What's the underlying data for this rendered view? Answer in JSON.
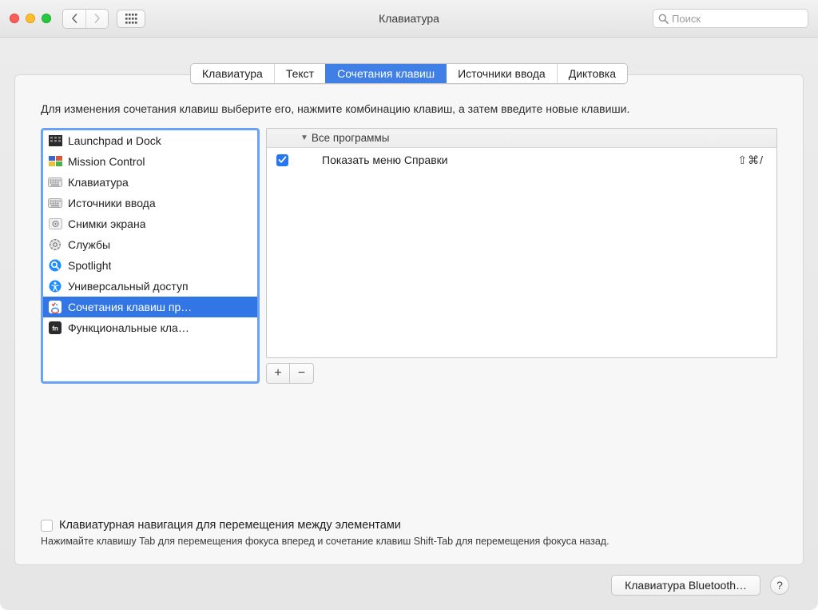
{
  "window": {
    "title": "Клавиатура"
  },
  "search": {
    "placeholder": "Поиск"
  },
  "tabs": [
    "Клавиатура",
    "Текст",
    "Сочетания клавиш",
    "Источники ввода",
    "Диктовка"
  ],
  "activeTab": 2,
  "instruction": "Для изменения сочетания клавиш выберите его, нажмите комбинацию клавиш, а затем введите новые клавиши.",
  "categories": [
    {
      "label": "Launchpad и Dock",
      "icon": "launchpad"
    },
    {
      "label": "Mission Control",
      "icon": "mission"
    },
    {
      "label": "Клавиатура",
      "icon": "keyboard"
    },
    {
      "label": "Источники ввода",
      "icon": "keyboard"
    },
    {
      "label": "Снимки экрана",
      "icon": "screenshot"
    },
    {
      "label": "Службы",
      "icon": "gear"
    },
    {
      "label": "Spotlight",
      "icon": "spotlight"
    },
    {
      "label": "Универсальный доступ",
      "icon": "accessibility"
    },
    {
      "label": "Сочетания клавиш пр…",
      "icon": "apps",
      "selected": true
    },
    {
      "label": "Функциональные кла…",
      "icon": "fn"
    }
  ],
  "detail": {
    "header": "Все программы",
    "items": [
      {
        "checked": true,
        "label": "Показать меню Справки",
        "shortcut": "⇧⌘/"
      }
    ]
  },
  "buttons": {
    "add": "+",
    "remove": "−"
  },
  "kbnav": {
    "label": "Клавиатурная навигация для перемещения между элементами",
    "hint": "Нажимайте клавишу Tab для перемещения фокуса вперед и сочетание клавиш Shift-Tab для перемещения фокуса назад."
  },
  "footer": {
    "bluetooth": "Клавиатура Bluetooth…",
    "help": "?"
  }
}
